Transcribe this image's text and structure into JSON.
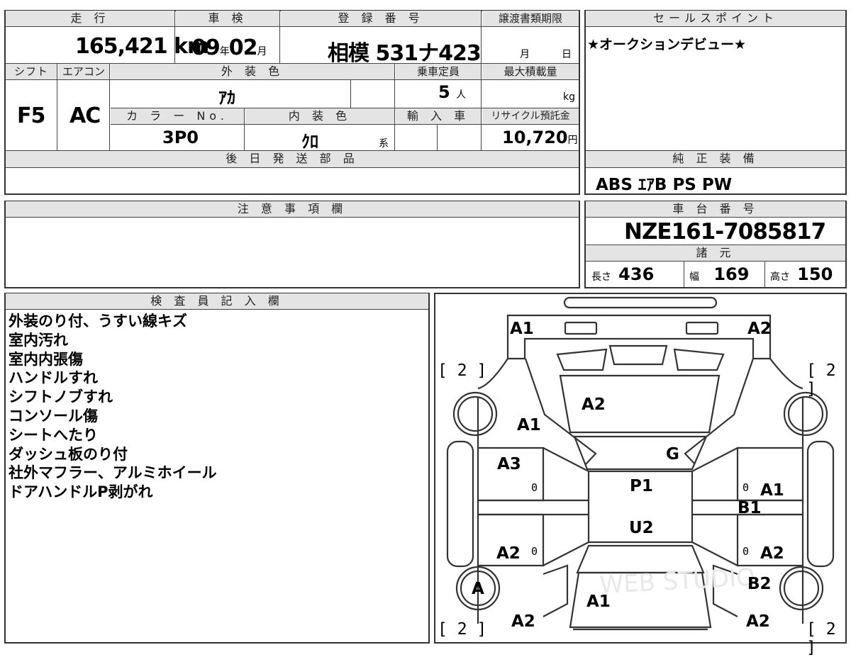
{
  "top_summary": {
    "mileage_label": "走 行",
    "mileage_value": "165,421",
    "mileage_unit": "km",
    "inspection_label": "車 検",
    "inspection_year": "09",
    "inspection_year_unit": "年",
    "inspection_month": "02",
    "inspection_month_unit": "月",
    "registration_label": "登 録 番 号",
    "registration_value": "相模 531ナ423",
    "transfer_label": "譲渡書類期限",
    "transfer_month_unit": "月",
    "transfer_day_unit": "日",
    "shift_label": "シフト",
    "shift_value": "F5",
    "ac_label": "エアコン",
    "ac_value": "AC",
    "exterior_color_label": "外 装 色",
    "exterior_color_value": "ｱｶ",
    "capacity_label": "乗車定員",
    "capacity_value": "5",
    "capacity_unit": "人",
    "max_load_label": "最大積載量",
    "max_load_unit": "kg",
    "color_no_label": "カ ラ ー No.",
    "color_no_value": "3P0",
    "interior_color_label": "内 装 色",
    "interior_color_value": "ｸﾛ",
    "interior_color_unit": "系",
    "import_label": "輸 入 車",
    "recycle_label": "リサイクル預託金",
    "recycle_value": "10,720",
    "recycle_unit": "円",
    "later_parts_label": "後 日 発 送 部 品"
  },
  "sales_point": {
    "label": "セールスポイント",
    "value": "★オークションデビュー★"
  },
  "equipment": {
    "label": "純 正 装 備",
    "value": "ABS ｴｱB PS PW"
  },
  "notes": {
    "label": "注 意 事 項 欄"
  },
  "chassis": {
    "label": "車 台 番 号",
    "value": "NZE161-7085817",
    "specs_label": "諸 元",
    "length_label": "長さ",
    "length_value": "436",
    "width_label": "幅",
    "width_value": "169",
    "height_label": "高さ",
    "height_value": "150"
  },
  "inspector": {
    "label": "検 査 員 記 入 欄",
    "lines": [
      "外装のり付、うすい線キズ",
      "室内汚れ",
      "室内内張傷",
      "ハンドルすれ",
      "シフトノブすれ",
      "コンソール傷",
      "シートへたり",
      "ダッシュ板のり付",
      "社外マフラー、アルミホイール",
      "ドアハンドルP剥がれ"
    ]
  },
  "diagram": {
    "front_left": "A1",
    "front_right": "A2",
    "windshield": "A2",
    "hood_left": "A1",
    "glass": "G",
    "left_front_door": "A3",
    "roof": "P1",
    "right_front_door": "A1",
    "right_pillar": "B1",
    "roof_rear": "U2",
    "left_rear_door": "A2",
    "right_rear_door": "A2",
    "left_rear_wheel": "A",
    "right_rear_wheel": "B2",
    "trunk": "A1",
    "rear_left": "A2",
    "rear_right": "A2",
    "tire_front_left": "[ 2 ]",
    "tire_front_right": "[ 2 ]",
    "tire_rear_left": "[ 2 ]",
    "tire_rear_right": "[ 2 ]",
    "zero_mark": "0",
    "watermark": "WEB STUDIO"
  }
}
